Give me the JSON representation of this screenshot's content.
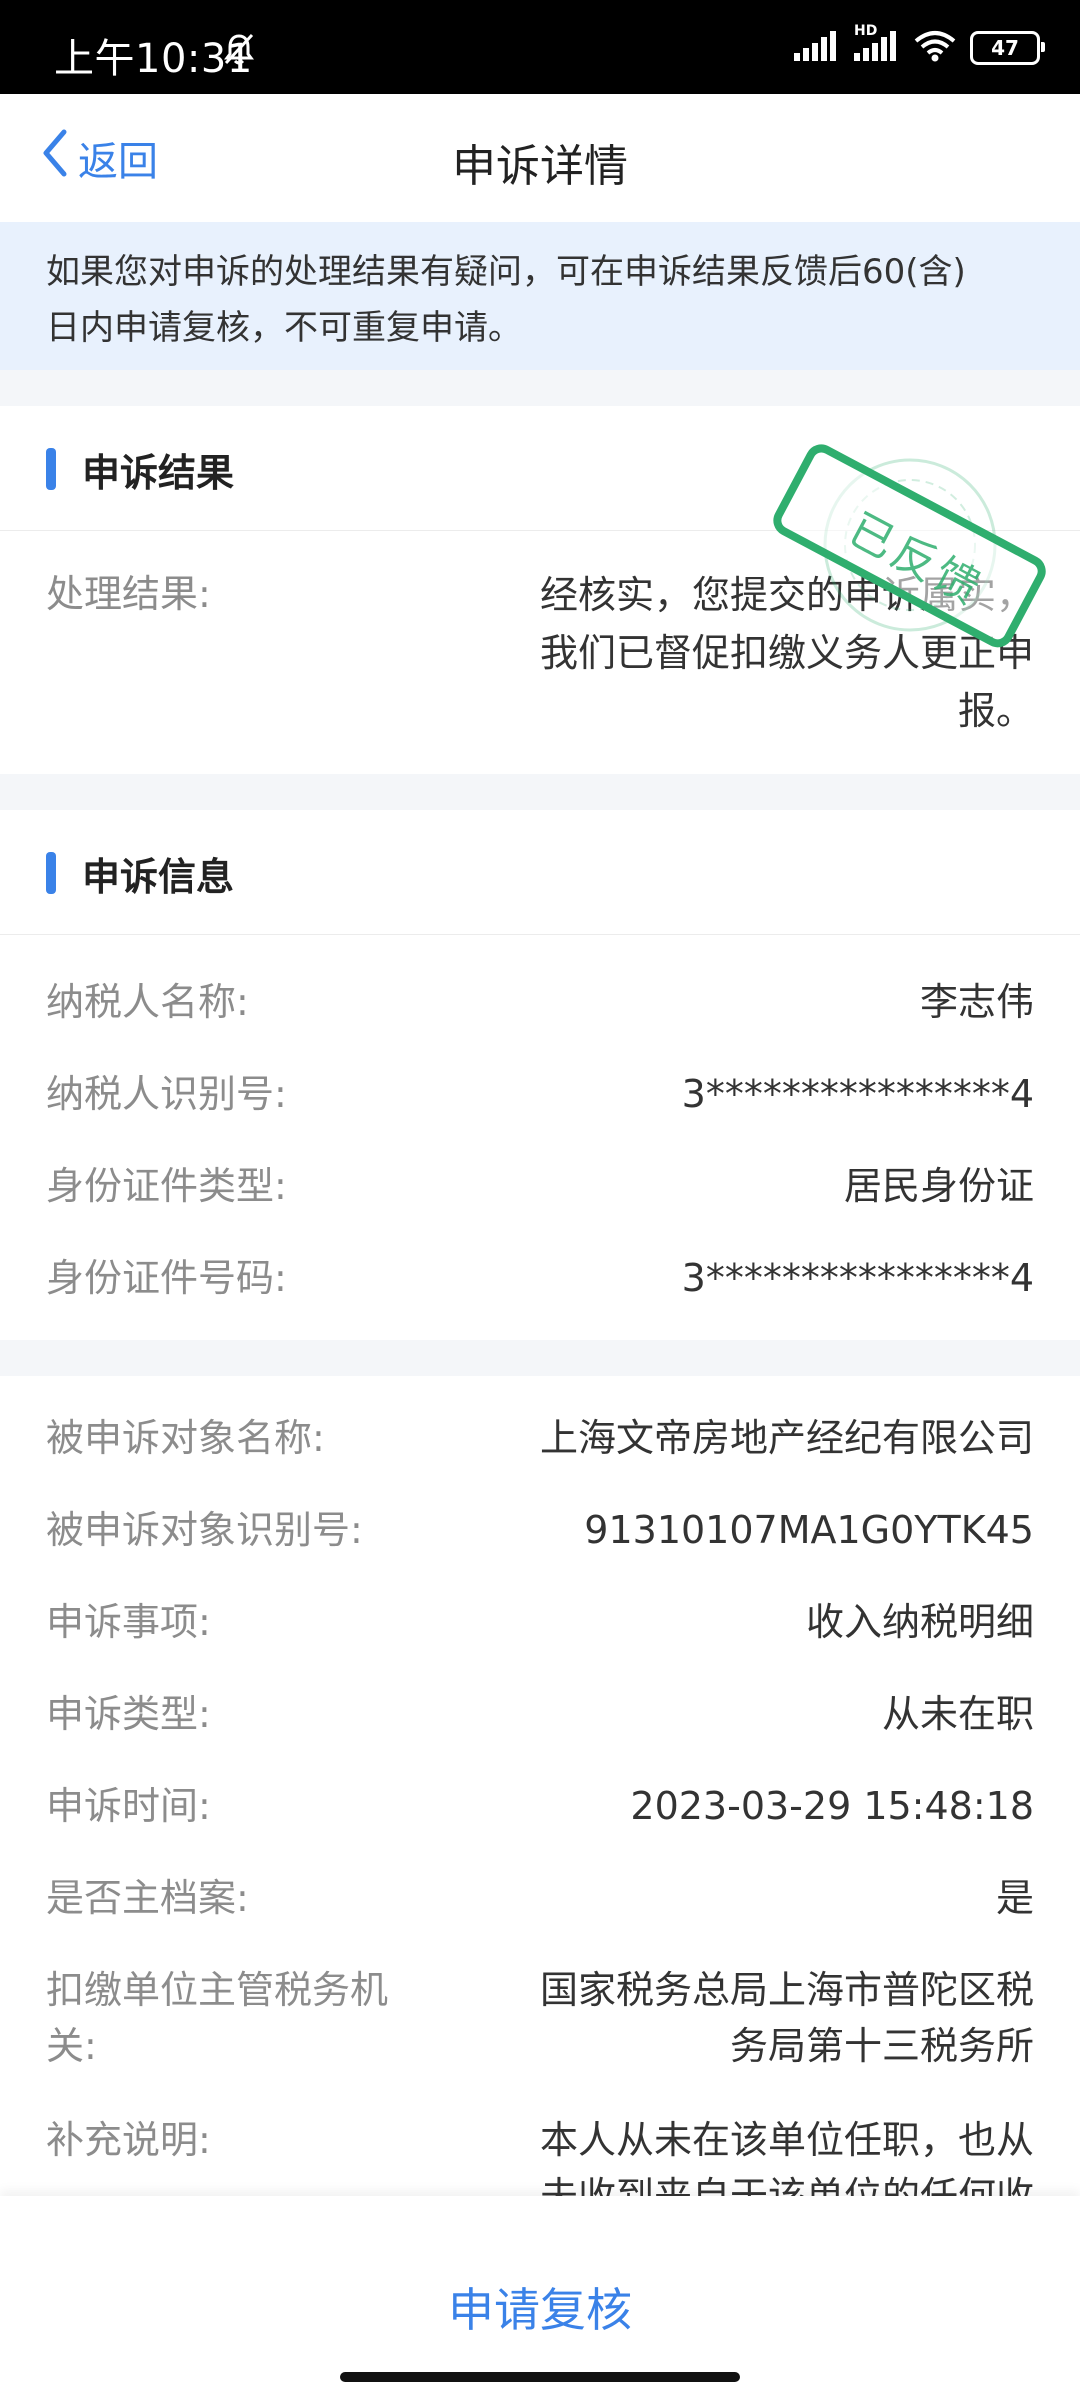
{
  "status": {
    "time": "上午10:31",
    "battery": "47",
    "hd": "HD"
  },
  "nav": {
    "back_label": "返回",
    "title": "申诉详情"
  },
  "notice": {
    "line1": "如果您对申诉的处理结果有疑问，可在申诉结果反馈后60(含)",
    "line2": "日内申请复核，不可重复申请。"
  },
  "result": {
    "section_title": "申诉结果",
    "label": "处理结果:",
    "value_lines": [
      "经核实，您提交的申诉属实，",
      "我们已督促扣缴义务人更正申",
      "报。"
    ],
    "stamp_text": "已反馈"
  },
  "info": {
    "section_title": "申诉信息",
    "rows": [
      {
        "label": "纳税人名称:",
        "value": "李志伟"
      },
      {
        "label": "纳税人识别号:",
        "value": "3****************4"
      },
      {
        "label": "身份证件类型:",
        "value": "居民身份证"
      },
      {
        "label": "身份证件号码:",
        "value": "3****************4"
      }
    ]
  },
  "detail": {
    "rows": [
      {
        "label": "被申诉对象名称:",
        "value": "上海文帝房地产经纪有限公司"
      },
      {
        "label": "被申诉对象识别号:",
        "value": "91310107MA1G0YTK45"
      },
      {
        "label": "申诉事项:",
        "value": "收入纳税明细"
      },
      {
        "label": "申诉类型:",
        "value": "从未在职"
      },
      {
        "label": "申诉时间:",
        "value": "2023-03-29 15:48:18"
      },
      {
        "label": "是否主档案:",
        "value": "是"
      }
    ],
    "authority": {
      "label_lines": [
        "扣缴单位主管税务机",
        "关:"
      ],
      "value_lines": [
        "国家税务总局上海市普陀区税",
        "务局第十三税务所"
      ]
    },
    "supplement": {
      "label": "补充说明:",
      "value_lines": [
        "本人从未在该单位任职，也从",
        "未收到来自于该单位的任何收"
      ]
    }
  },
  "bottom": {
    "button_label": "申请复核"
  },
  "colors": {
    "accent": "#3a82e8",
    "stamp": "#2fae6e",
    "notice_bg": "#e8f1fd"
  }
}
